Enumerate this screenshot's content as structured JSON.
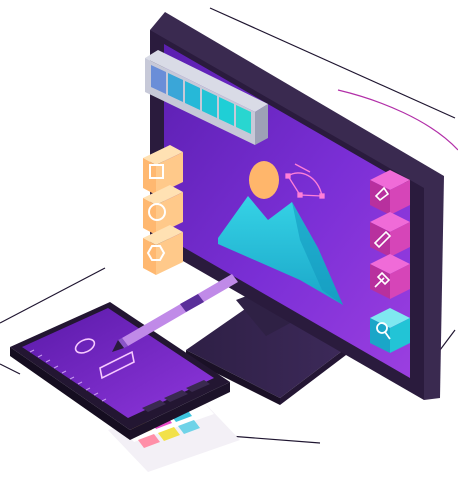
{
  "illustration": {
    "subject": "graphic-design-workstation",
    "colors": {
      "frame_dark": "#2a1b3d",
      "screen_purple": "#7b2fd6",
      "screen_violet": "#9b3fe0",
      "cyan": "#22c4d6",
      "peach": "#ffc98a",
      "magenta": "#e040c8",
      "pink_tool": "#d645b8",
      "sun": "#ffb66b"
    },
    "palette_swatches": [
      "#6a8ed8",
      "#3aa6d8",
      "#26b8d8",
      "#22c4d6",
      "#1fcfd6",
      "#29d6d0"
    ],
    "shape_tools": [
      "square-icon",
      "circle-icon",
      "hexagon-icon"
    ],
    "side_tools": [
      "pen-nib-icon",
      "pencil-icon",
      "dropper-icon",
      "magnifier-icon"
    ],
    "card_swatches": [
      "#ffd36b",
      "#e84ac8",
      "#3ec6e0",
      "#ff8fa8",
      "#f2e14a",
      "#6fd3e8"
    ]
  }
}
